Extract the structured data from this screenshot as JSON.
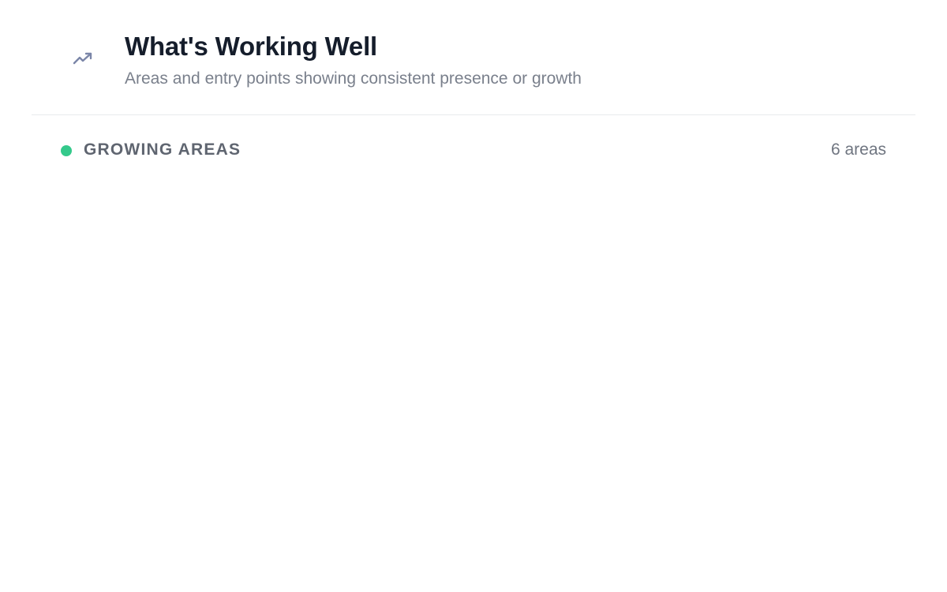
{
  "header": {
    "title": "What's Working Well",
    "subtitle": "Areas and entry points showing consistent presence or growth",
    "icon": "trending-up-icon"
  },
  "growing_areas": {
    "label": "GROWING AREAS",
    "count_label": "6 areas",
    "status_color": "#34c98b"
  },
  "colors": {
    "title": "#151d2b",
    "subtitle": "#7a808c",
    "icon": "#7b86a8",
    "divider": "#e8eaed",
    "label": "#5f6570",
    "count": "#6f7580"
  }
}
